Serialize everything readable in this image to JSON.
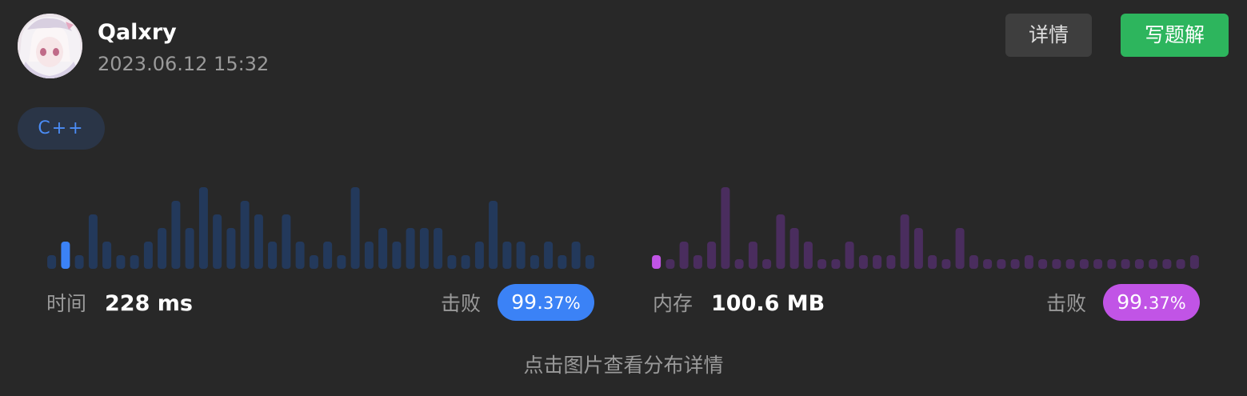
{
  "user": {
    "name": "Qalxry",
    "timestamp": "2023.06.12 15:32"
  },
  "buttons": {
    "detail_label": "详情",
    "write_solution_label": "写题解"
  },
  "language_tag": "C++",
  "runtime": {
    "label": "时间",
    "value": "228 ms",
    "beat_label": "击败",
    "beat_percent_main": "99.",
    "beat_percent_small": "37%",
    "color": "#3b82f6",
    "bar_color": "#23395b",
    "highlight_index": 1,
    "bars": [
      1,
      2,
      1,
      4,
      2,
      1,
      1,
      2,
      3,
      5,
      3,
      6,
      4,
      3,
      5,
      4,
      2,
      4,
      2,
      1,
      2,
      1,
      6,
      2,
      3,
      2,
      3,
      3,
      3,
      1,
      1,
      2,
      5,
      2,
      2,
      1,
      2,
      1,
      2,
      1
    ]
  },
  "memory": {
    "label": "内存",
    "value": "100.6 MB",
    "beat_label": "击败",
    "beat_percent_main": "99.",
    "beat_percent_small": "37%",
    "color": "#c154e6",
    "bar_color": "#4a2d5e",
    "highlight_index": 0,
    "bars": [
      1,
      0.5,
      2,
      1,
      2,
      6,
      0.5,
      2,
      0.5,
      4,
      3,
      2,
      0.5,
      0.5,
      2,
      1,
      1,
      1,
      4,
      3,
      1,
      0.5,
      3,
      1,
      0.5,
      0.5,
      0.5,
      1,
      0.5,
      0.5,
      0.5,
      0.5,
      0.5,
      0.5,
      0.5,
      0.5,
      0.5,
      0.5,
      0.5,
      1
    ]
  },
  "hint_text": "点击图片查看分布详情"
}
